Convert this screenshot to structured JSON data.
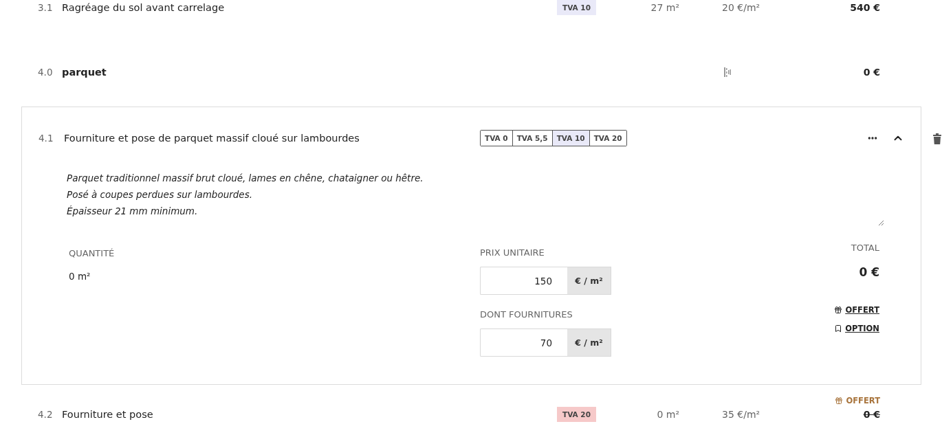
{
  "lines": [
    {
      "kind": "item",
      "number": "3.1",
      "title": "Ragréage du sol avant carrelage",
      "tva": {
        "label": "TVA 10",
        "color": "#e9e9f8"
      },
      "quantity": "27 m²",
      "unit_price": "20 €/m²",
      "total": "540 €",
      "offered": false
    },
    {
      "kind": "section",
      "number": "4.0",
      "title": "parquet",
      "total": "0 €"
    },
    {
      "kind": "editor",
      "number": "4.1",
      "title": "Fourniture et pose de parquet massif cloué sur lambourdes",
      "tva_options": [
        {
          "label": "TVA 0",
          "selected": false
        },
        {
          "label": "TVA 5,5",
          "selected": false
        },
        {
          "label": "TVA 10",
          "selected": true
        },
        {
          "label": "TVA 20",
          "selected": false
        }
      ],
      "expanded": true,
      "description": "Parquet traditionnel massif brut cloué, lames en chêne, chataigner ou hêtre.\nPosé à coupes perdues sur lambourdes.\nÉpaisseur 21 mm minimum.",
      "quantity": {
        "label": "QUANTITÉ",
        "value": "0 m²"
      },
      "unit_price": {
        "label": "PRIX UNITAIRE",
        "value": "150",
        "unit": "€ / m²"
      },
      "supplies": {
        "label": "DONT FOURNITURES",
        "value": "70",
        "unit": "€ / m²"
      },
      "total": {
        "label": "TOTAL",
        "value": "0 €"
      },
      "actions": [
        {
          "kind": "offered",
          "label": "OFFERT"
        },
        {
          "kind": "option",
          "label": "OPTION"
        }
      ]
    },
    {
      "kind": "item",
      "number": "4.2",
      "title": "Fourniture et pose",
      "tva": {
        "label": "TVA 20",
        "color": "#f6c9c9"
      },
      "quantity": "0 m²",
      "unit_price": "35 €/m²",
      "total": "0 €",
      "offered": true,
      "offered_label": "OFFERT"
    }
  ]
}
